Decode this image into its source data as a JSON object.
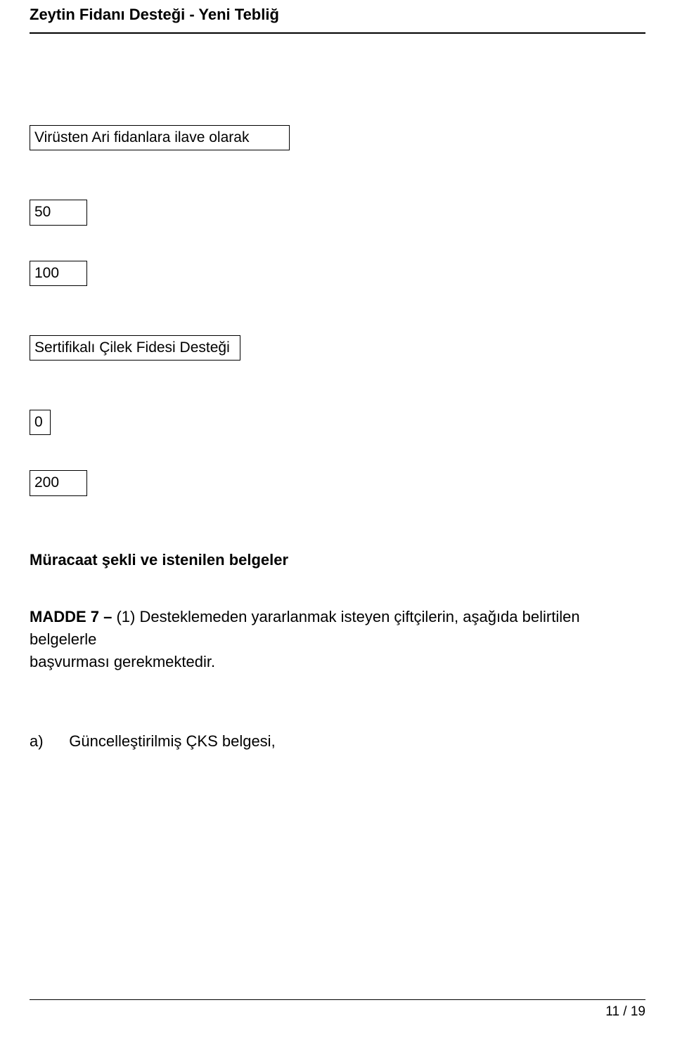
{
  "header": {
    "title": "Zeytin Fidanı Desteği - Yeni Tebliğ"
  },
  "boxes": {
    "virusten": "Virüsten Ari fidanlara  ilave olarak",
    "v50": "50",
    "v100": "100",
    "sertifikali": "Sertifikalı Çilek  Fidesi Desteği",
    "v0": "0",
    "v200": "200"
  },
  "sectionHeading": "Müracaat  şekli ve istenilen belgeler",
  "madde7": {
    "lead": " MADDE 7 – ",
    "body_part1": "(1) Desteklemeden yararlanmak isteyen  çiftçilerin,",
    "body_part2_indent": "       aşağıda belirtilen belgelerle",
    "body_part3": "başvurması gerekmektedir."
  },
  "itemA": {
    "label": "a)",
    "text": "Güncelleştirilmiş ÇKS belgesi,"
  },
  "footer": {
    "pageNumber": "11 / 19"
  }
}
